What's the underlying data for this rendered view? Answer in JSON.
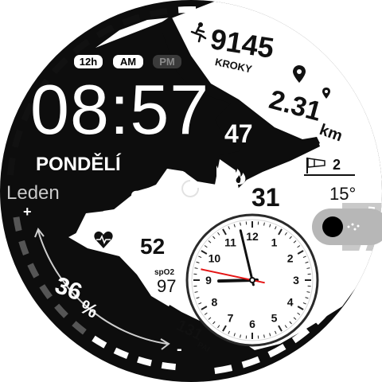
{
  "watchface": {
    "time_format_label": "12h",
    "am_label": "AM",
    "pm_label": "PM",
    "time": "08:57",
    "weekday": "PONDĚLÍ",
    "month": "Leden",
    "plus_label": "+",
    "minus_label": "-",
    "seconds_value": "47",
    "day_of_month": "31",
    "small_value_9": "9",
    "battery_percent": "36",
    "percent_sign": "%",
    "steps": {
      "value": "9145",
      "label": "KROKY",
      "icon": "runner-icon"
    },
    "distance": {
      "value": "2.31",
      "unit": "km",
      "icon": "location-pin-icon"
    },
    "wind": {
      "value": "2",
      "icon": "windsock-icon"
    },
    "temperature": "15°",
    "heart_rate": {
      "value": "52",
      "icon": "heart-pulse-icon"
    },
    "spo2": {
      "label": "spO2",
      "value": "97"
    },
    "pai": {
      "value": "131",
      "label": "PAI"
    },
    "analog_clock": {
      "numerals": [
        "1",
        "2",
        "3",
        "4",
        "5",
        "6",
        "7",
        "8",
        "9",
        "10",
        "11",
        "12"
      ],
      "hour": 8,
      "minute": 57,
      "second": 47
    },
    "colors": {
      "dial_bg": "#0d0d0d",
      "wolf_white": "#ffffff",
      "accent_red": "#e41414",
      "toggle_grey": "#b5b5b5"
    }
  }
}
